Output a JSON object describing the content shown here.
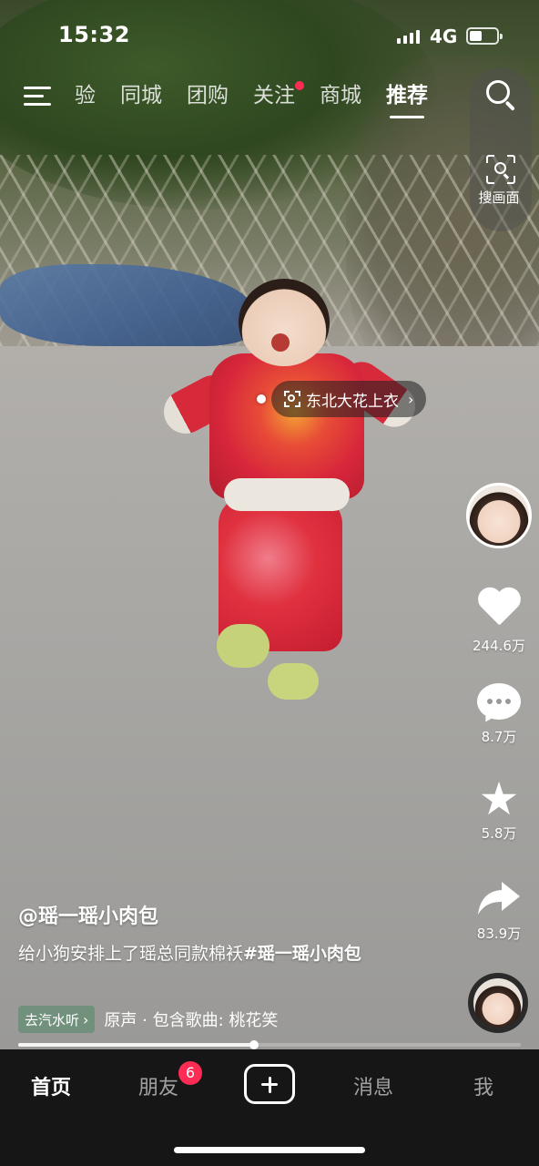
{
  "status_bar": {
    "time": "15:32",
    "network": "4G",
    "battery_level": 0.45
  },
  "top_nav": {
    "tabs": [
      {
        "label": "验",
        "active": false,
        "dot": false
      },
      {
        "label": "同城",
        "active": false,
        "dot": false
      },
      {
        "label": "团购",
        "active": false,
        "dot": false
      },
      {
        "label": "关注",
        "active": false,
        "dot": true
      },
      {
        "label": "商城",
        "active": false,
        "dot": false
      },
      {
        "label": "推荐",
        "active": true,
        "dot": false
      }
    ],
    "image_search_label": "搜画面",
    "icons": [
      "menu-icon",
      "search-icon",
      "image-search-icon"
    ]
  },
  "product_tag": {
    "text": "东北大花上衣"
  },
  "side_rail": {
    "likes": "244.6万",
    "comments": "8.7万",
    "favorites": "5.8万",
    "shares": "83.9万",
    "icons": [
      "avatar",
      "heart-icon",
      "comment-icon",
      "star-icon",
      "share-icon",
      "music-disc"
    ]
  },
  "caption": {
    "author": "@瑶一瑶小肉包",
    "description_prefix": "给小狗安排上了瑶总同款棉袄",
    "hashtag": "#瑶一瑶小肉包",
    "qishui_label": "去汽水听",
    "music": "原声 · 包含歌曲: 桃花笑"
  },
  "progress": {
    "fraction": 0.47
  },
  "bottom_nav": {
    "items": [
      {
        "label": "首页",
        "active": true
      },
      {
        "label": "朋友",
        "active": false,
        "badge": "6"
      },
      {
        "label": "",
        "type": "create"
      },
      {
        "label": "消息",
        "active": false
      },
      {
        "label": "我",
        "active": false
      }
    ]
  },
  "colors": {
    "accent": "#fe2c55",
    "bottom_bar": "#161616"
  }
}
